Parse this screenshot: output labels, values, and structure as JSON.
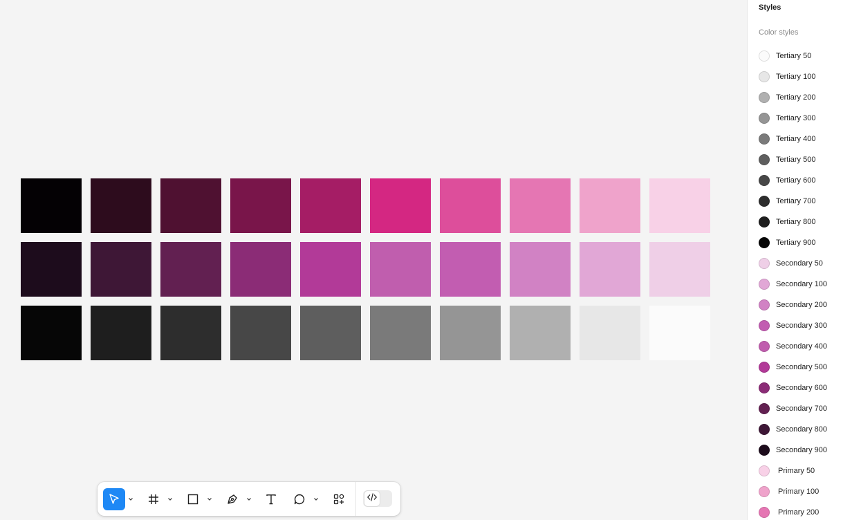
{
  "canvas": {
    "swatch_rows": [
      [
        "#040104",
        "#2d0c1d",
        "#4f1131",
        "#79154a",
        "#a51d65",
        "#d42782",
        "#dd4e9b",
        "#e576b3",
        "#efa3cb",
        "#f8d1e7"
      ],
      [
        "#1d0c1c",
        "#3e1736",
        "#622051",
        "#8b2c76",
        "#b23a98",
        "#c05eae",
        "#c25db1",
        "#d182c4",
        "#e1a7d6",
        "#efcfe7"
      ],
      [
        "#060606",
        "#1e1e1e",
        "#2d2d2d",
        "#474747",
        "#5e5e5e",
        "#7a7a7a",
        "#959595",
        "#b0b0b0",
        "#e7e7e7",
        "#fbfbfb"
      ]
    ]
  },
  "toolbar": {
    "tools": [
      {
        "name": "move",
        "icon": "pointer-icon",
        "selected": true
      },
      {
        "name": "frame",
        "icon": "frame-icon"
      },
      {
        "name": "shape",
        "icon": "rectangle-icon"
      },
      {
        "name": "pen",
        "icon": "pen-icon"
      },
      {
        "name": "text",
        "icon": "text-icon"
      },
      {
        "name": "comment",
        "icon": "comment-icon"
      },
      {
        "name": "actions",
        "icon": "actions-icon"
      }
    ],
    "dev_mode_icon": "code-icon"
  },
  "panel": {
    "title": "Styles",
    "subtitle": "Color styles",
    "styles": [
      {
        "label": "Tertiary 50",
        "color": "#fbfbfb",
        "group": "tertiary"
      },
      {
        "label": "Tertiary 100",
        "color": "#e7e7e7",
        "group": "tertiary"
      },
      {
        "label": "Tertiary 200",
        "color": "#b0b0b0",
        "group": "tertiary"
      },
      {
        "label": "Tertiary 300",
        "color": "#959595",
        "group": "tertiary"
      },
      {
        "label": "Tertiary 400",
        "color": "#7a7a7a",
        "group": "tertiary"
      },
      {
        "label": "Tertiary 500",
        "color": "#5e5e5e",
        "group": "tertiary"
      },
      {
        "label": "Tertiary 600",
        "color": "#474747",
        "group": "tertiary"
      },
      {
        "label": "Tertiary 700",
        "color": "#2d2d2d",
        "group": "tertiary"
      },
      {
        "label": "Tertiary 800",
        "color": "#1e1e1e",
        "group": "tertiary"
      },
      {
        "label": "Tertiary 900",
        "color": "#060606",
        "group": "tertiary"
      },
      {
        "label": "Secondary 50",
        "color": "#efcfe7",
        "group": "secondary"
      },
      {
        "label": "Secondary 100",
        "color": "#e1a7d6",
        "group": "secondary"
      },
      {
        "label": "Secondary 200",
        "color": "#d182c4",
        "group": "secondary"
      },
      {
        "label": "Secondary 300",
        "color": "#c25db1",
        "group": "secondary"
      },
      {
        "label": "Secondary 400",
        "color": "#c05eae",
        "group": "secondary"
      },
      {
        "label": "Secondary 500",
        "color": "#b23a98",
        "group": "secondary"
      },
      {
        "label": "Secondary 600",
        "color": "#8b2c76",
        "group": "secondary"
      },
      {
        "label": "Secondary 700",
        "color": "#622051",
        "group": "secondary"
      },
      {
        "label": "Secondary 800",
        "color": "#3e1736",
        "group": "secondary"
      },
      {
        "label": "Secondary 900",
        "color": "#1d0c1c",
        "group": "secondary"
      },
      {
        "label": "Primary 50",
        "color": "#f8d1e7",
        "group": "primary"
      },
      {
        "label": "Primary 100",
        "color": "#efa3cb",
        "group": "primary"
      },
      {
        "label": "Primary 200",
        "color": "#e576b3",
        "group": "primary"
      }
    ]
  }
}
